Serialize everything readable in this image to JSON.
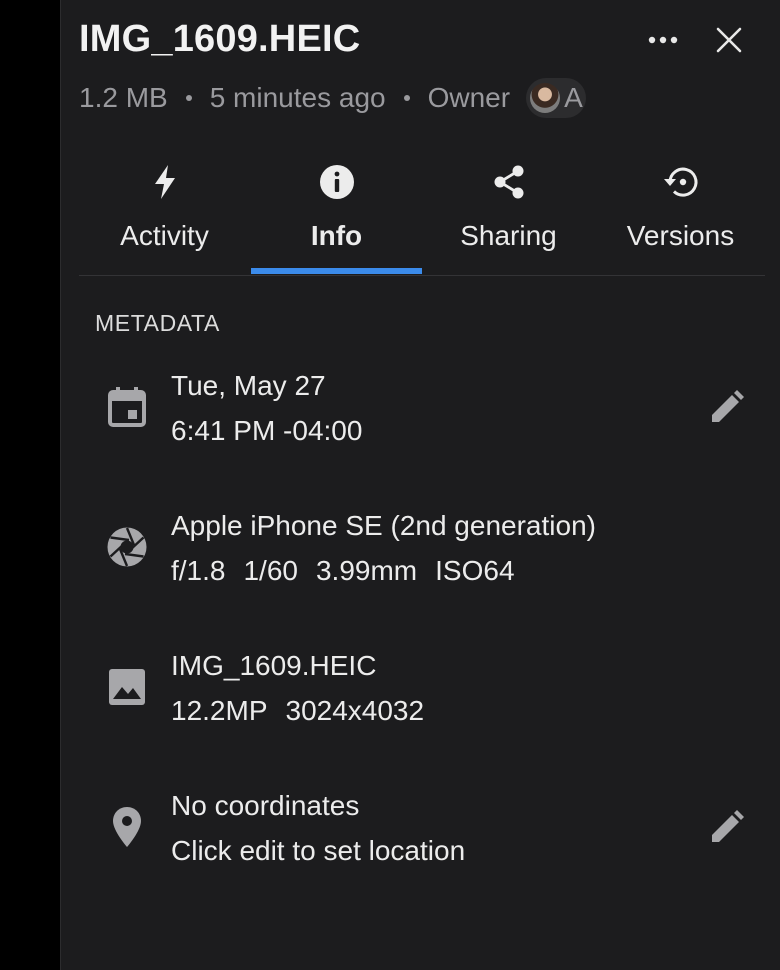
{
  "file": {
    "name": "IMG_1609.HEIC",
    "size": "1.2 MB",
    "modified": "5 minutes ago",
    "owner_label": "Owner",
    "owner_initial": "A"
  },
  "header": {
    "more_icon": "more-horizontal-icon",
    "close_icon": "close-icon"
  },
  "tabs": [
    {
      "label": "Activity",
      "icon": "bolt-icon",
      "active": false
    },
    {
      "label": "Info",
      "icon": "info-icon",
      "active": true
    },
    {
      "label": "Sharing",
      "icon": "share-icon",
      "active": false
    },
    {
      "label": "Versions",
      "icon": "history-icon",
      "active": false
    }
  ],
  "metadata": {
    "section_title": "METADATA",
    "date": {
      "icon": "calendar-icon",
      "line1": "Tue, May 27",
      "line2": "6:41 PM -04:00"
    },
    "camera": {
      "icon": "camera-aperture-icon",
      "line1": "Apple iPhone SE (2nd generation)",
      "aperture": "f/1.8",
      "shutter": "1/60",
      "focal_length": "3.99mm",
      "iso": "ISO64"
    },
    "image": {
      "icon": "image-icon",
      "line1": "IMG_1609.HEIC",
      "megapixels": "12.2MP",
      "dimensions": "3024x4032"
    },
    "location": {
      "icon": "map-pin-icon",
      "line1": "No coordinates",
      "line2": "Click edit to set location"
    }
  },
  "colors": {
    "panel_bg": "#1c1c1e",
    "accent": "#3b8beb",
    "muted_text": "#9a9a9e",
    "icon_gray": "#a7a7aa"
  }
}
